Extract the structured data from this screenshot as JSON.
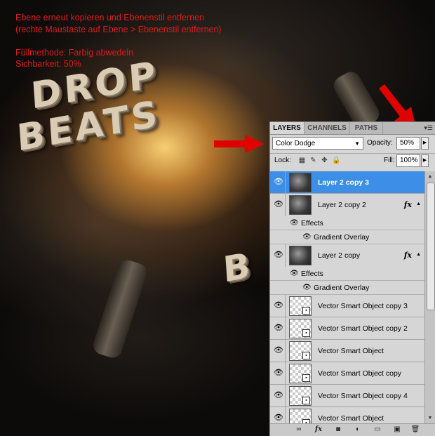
{
  "annotation": {
    "line1": "Ebene erneut kopieren und Ebenenstil entfernen",
    "line2": "(rechte Maustaste auf Ebene > Ebenenstil entfernen)",
    "line3": "Füllmethode: Farbig abwedeln",
    "line4": "Sichbarkeit: 50%",
    "color": "#e01a1a"
  },
  "artwork": {
    "word1": "DROP",
    "word2": "BEATS",
    "word3": "B"
  },
  "panel": {
    "tabs": [
      "LAYERS",
      "CHANNELS",
      "PATHS"
    ],
    "active_tab": "LAYERS",
    "blend_mode": "Color Dodge",
    "opacity_label": "Opacity:",
    "opacity_value": "50%",
    "lock_label": "Lock:",
    "fill_label": "Fill:",
    "fill_value": "100%",
    "layers": [
      {
        "name": "Layer 2 copy 3",
        "selected": true
      },
      {
        "name": "Layer 2 copy 2",
        "fx": "fx",
        "effects": "Effects",
        "effect": "Gradient Overlay"
      },
      {
        "name": "Layer 2 copy",
        "fx": "fx",
        "effects": "Effects",
        "effect": "Gradient Overlay"
      },
      {
        "name": "Vector Smart Object copy 3"
      },
      {
        "name": "Vector Smart Object copy 2"
      },
      {
        "name": "Vector Smart Object"
      },
      {
        "name": "Vector Smart Object copy"
      },
      {
        "name": "Vector Smart Object copy 4"
      },
      {
        "name": "Vector Smart Object"
      }
    ],
    "selected_color": "#3d8ee6"
  },
  "icons": {
    "visibility": "eye-icon",
    "fx": "fx-icon",
    "arrow": "red-arrow-icon"
  }
}
